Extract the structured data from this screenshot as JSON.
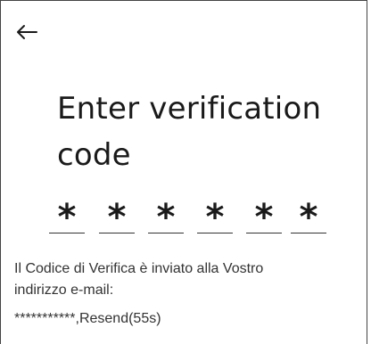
{
  "nav": {
    "back_icon": "arrow-left-icon"
  },
  "page": {
    "title_line1": "Enter verification",
    "title_line2": "code"
  },
  "code": {
    "digits": [
      "*",
      "*",
      "*",
      "*",
      "*",
      "*"
    ]
  },
  "info": {
    "line1": "Il Codice di Verifica è inviato alla Vostro",
    "line2": "indirizzo e-mail:"
  },
  "email": {
    "masked": "***********",
    "separator": ",",
    "resend_label": "Resend(55s)"
  },
  "colors": {
    "text": "#1a1a1a",
    "secondary_text": "#333333",
    "border": "#444444"
  }
}
